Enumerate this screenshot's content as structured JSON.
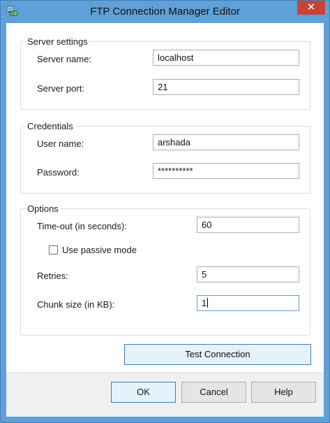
{
  "window": {
    "title": "FTP Connection Manager Editor",
    "close_glyph": "✕"
  },
  "server_settings": {
    "title": "Server settings",
    "server_name_label": "Server name:",
    "server_name_value": "localhost",
    "server_port_label": "Server port:",
    "server_port_value": "21"
  },
  "credentials": {
    "title": "Credentials",
    "user_name_label": "User name:",
    "user_name_value": "arshada",
    "password_label": "Password:",
    "password_value": "**********"
  },
  "options": {
    "title": "Options",
    "timeout_label": "Time-out (in seconds):",
    "timeout_value": "60",
    "passive_mode_label": "Use passive mode",
    "passive_mode_checked": false,
    "retries_label": "Retries:",
    "retries_value": "5",
    "chunk_size_label": "Chunk size (in KB):",
    "chunk_size_value": "1"
  },
  "buttons": {
    "test_connection": "Test Connection",
    "ok": "OK",
    "cancel": "Cancel",
    "help": "Help"
  },
  "colors": {
    "title_bar": "#5fa0d8",
    "close_button": "#c9413b",
    "focus_border": "#569de5"
  },
  "icons": {
    "title": "ftp-connection-icon",
    "close": "close-icon"
  }
}
